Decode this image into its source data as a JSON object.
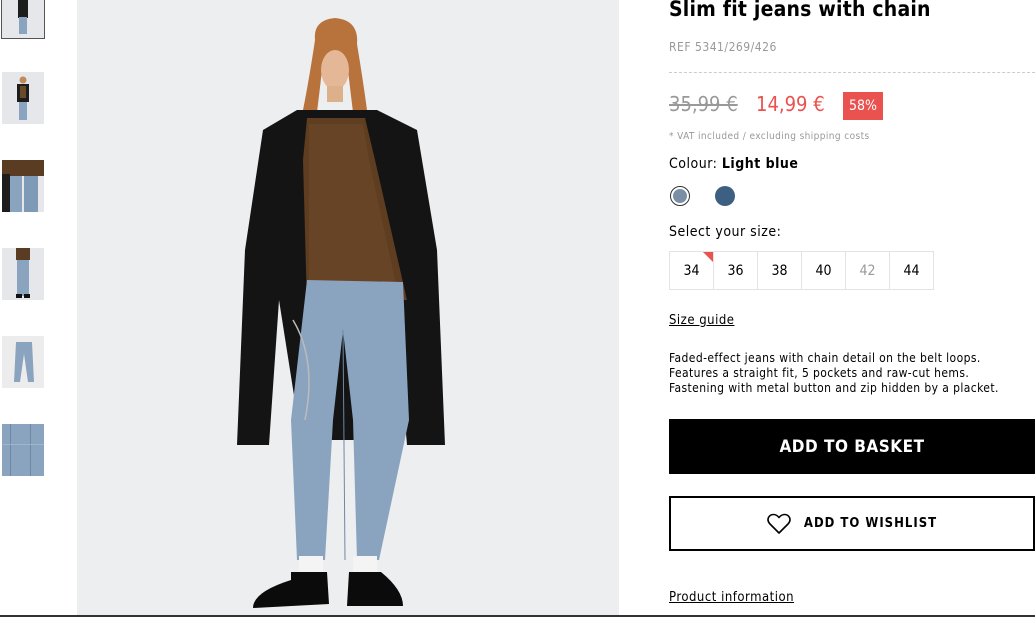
{
  "thumbnails": [
    {
      "name": "thumbnail-1",
      "active": true
    },
    {
      "name": "thumbnail-2",
      "active": false
    },
    {
      "name": "thumbnail-3",
      "active": false
    },
    {
      "name": "thumbnail-4",
      "active": false
    },
    {
      "name": "thumbnail-5",
      "active": false
    },
    {
      "name": "thumbnail-6",
      "active": false
    }
  ],
  "product": {
    "title": "Slim fit jeans with chain",
    "ref": "REF 5341/269/426",
    "old_price": "35,99 €",
    "new_price": "14,99 €",
    "discount": "58%",
    "vat_note": "* VAT included / excluding shipping costs",
    "colour_label": "Colour:",
    "colour_value": "Light blue",
    "colours": [
      {
        "name": "Light blue",
        "hex": "#7a8fa6",
        "selected": true
      },
      {
        "name": "Dark blue",
        "hex": "#3d5f82",
        "selected": false
      }
    ],
    "size_label": "Select your size:",
    "sizes": [
      {
        "label": "34",
        "available": true,
        "few_left": true
      },
      {
        "label": "36",
        "available": true,
        "few_left": false
      },
      {
        "label": "38",
        "available": true,
        "few_left": false
      },
      {
        "label": "40",
        "available": true,
        "few_left": false
      },
      {
        "label": "42",
        "available": false,
        "few_left": false
      },
      {
        "label": "44",
        "available": true,
        "few_left": false
      }
    ],
    "size_guide": "Size guide",
    "description": [
      "Faded-effect jeans with chain detail on the belt loops.",
      "Features a straight fit, 5 pockets and raw-cut hems.",
      "Fastening with metal button and zip hidden by a placket."
    ],
    "add_to_basket": "ADD TO BASKET",
    "add_to_wishlist": "ADD TO WISHLIST",
    "product_information": "Product information"
  },
  "colors": {
    "accent": "#e9524f",
    "muted": "#999999",
    "button": "#000000"
  },
  "icons": {
    "wishlist": "heart-icon"
  }
}
